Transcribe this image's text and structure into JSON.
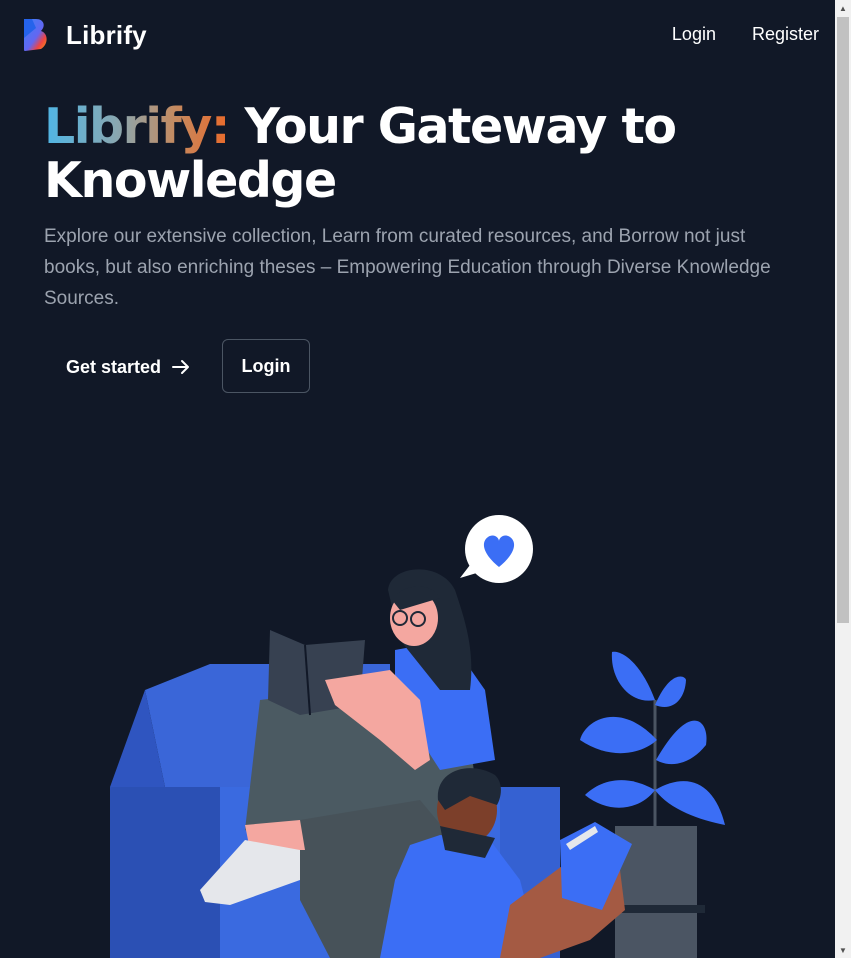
{
  "nav": {
    "brand": "Librify",
    "links": [
      "Login",
      "Register"
    ]
  },
  "hero": {
    "title_highlight": "Librify:",
    "title_rest": " Your Gateway to Knowledge",
    "subtitle": "Explore our extensive collection, Learn from curated resources, and Borrow not just books, but also enriching theses – Empowering Education through Diverse Knowledge Sources.",
    "primary_button": "Get started",
    "secondary_button": "Login"
  },
  "colors": {
    "background": "#111827",
    "accent_blue": "#3b6ef5",
    "gradient_start": "#4fb6e6",
    "gradient_end": "#ea6a2a"
  },
  "icons": {
    "logo": "librify-logo-icon",
    "arrow": "arrow-right-icon",
    "heart": "heart-icon"
  }
}
